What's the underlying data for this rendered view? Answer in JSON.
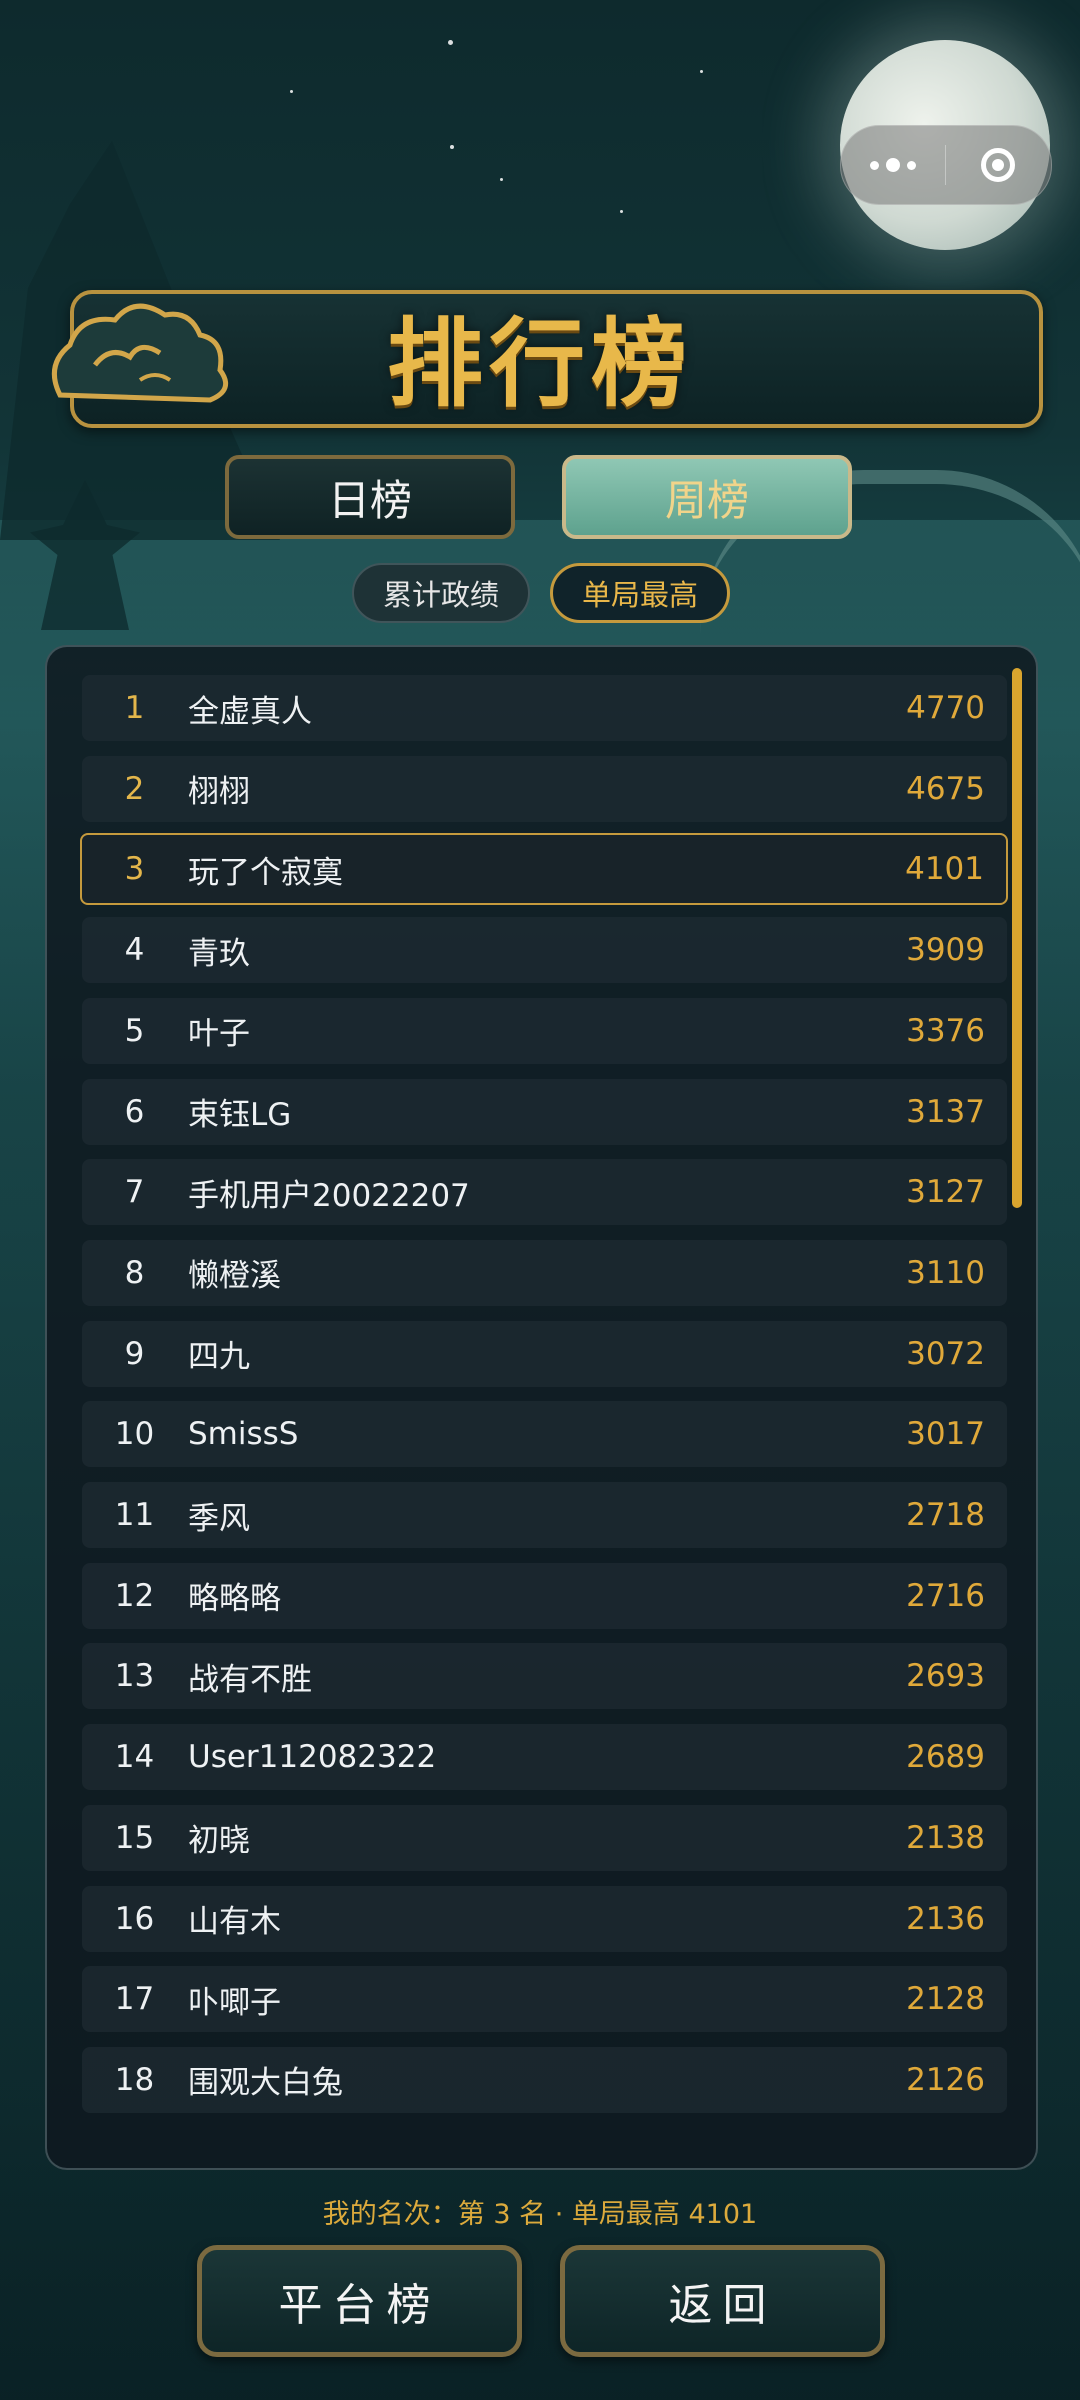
{
  "header": {
    "title": "排行榜"
  },
  "tabs": {
    "day_label": "日榜",
    "week_label": "周榜",
    "active": "week"
  },
  "filters": {
    "total_label": "累计政绩",
    "single_label": "单局最高",
    "active": "single"
  },
  "capsule": {
    "more_icon": "more-dots-icon",
    "close_icon": "target-icon"
  },
  "leaderboard": [
    {
      "rank": "1",
      "name": "全虚真人",
      "score": "4770"
    },
    {
      "rank": "2",
      "name": "栩栩",
      "score": "4675"
    },
    {
      "rank": "3",
      "name": "玩了个寂寞",
      "score": "4101"
    },
    {
      "rank": "4",
      "name": "青玖",
      "score": "3909"
    },
    {
      "rank": "5",
      "name": "叶子",
      "score": "3376"
    },
    {
      "rank": "6",
      "name": "束钰LG",
      "score": "3137"
    },
    {
      "rank": "7",
      "name": "手机用户20022207",
      "score": "3127"
    },
    {
      "rank": "8",
      "name": "懒橙溪",
      "score": "3110"
    },
    {
      "rank": "9",
      "name": "四九",
      "score": "3072"
    },
    {
      "rank": "10",
      "name": "SmissS",
      "score": "3017"
    },
    {
      "rank": "11",
      "name": "季风",
      "score": "2718"
    },
    {
      "rank": "12",
      "name": "略略略",
      "score": "2716"
    },
    {
      "rank": "13",
      "name": "战有不胜",
      "score": "2693"
    },
    {
      "rank": "14",
      "name": "User112082322",
      "score": "2689"
    },
    {
      "rank": "15",
      "name": "初晓",
      "score": "2138"
    },
    {
      "rank": "16",
      "name": "山有木",
      "score": "2136"
    },
    {
      "rank": "17",
      "name": "卟唧子",
      "score": "2128"
    },
    {
      "rank": "18",
      "name": "围观大白兔",
      "score": "2126"
    }
  ],
  "my_rank_text": "我的名次：第 3 名 · 单局最高 4101",
  "buttons": {
    "platform_label": "平台榜",
    "back_label": "返回"
  },
  "colors": {
    "accent_gold": "#e0a93a",
    "panel_bg": "#0f1920",
    "active_tab": "#7fb9a5"
  }
}
